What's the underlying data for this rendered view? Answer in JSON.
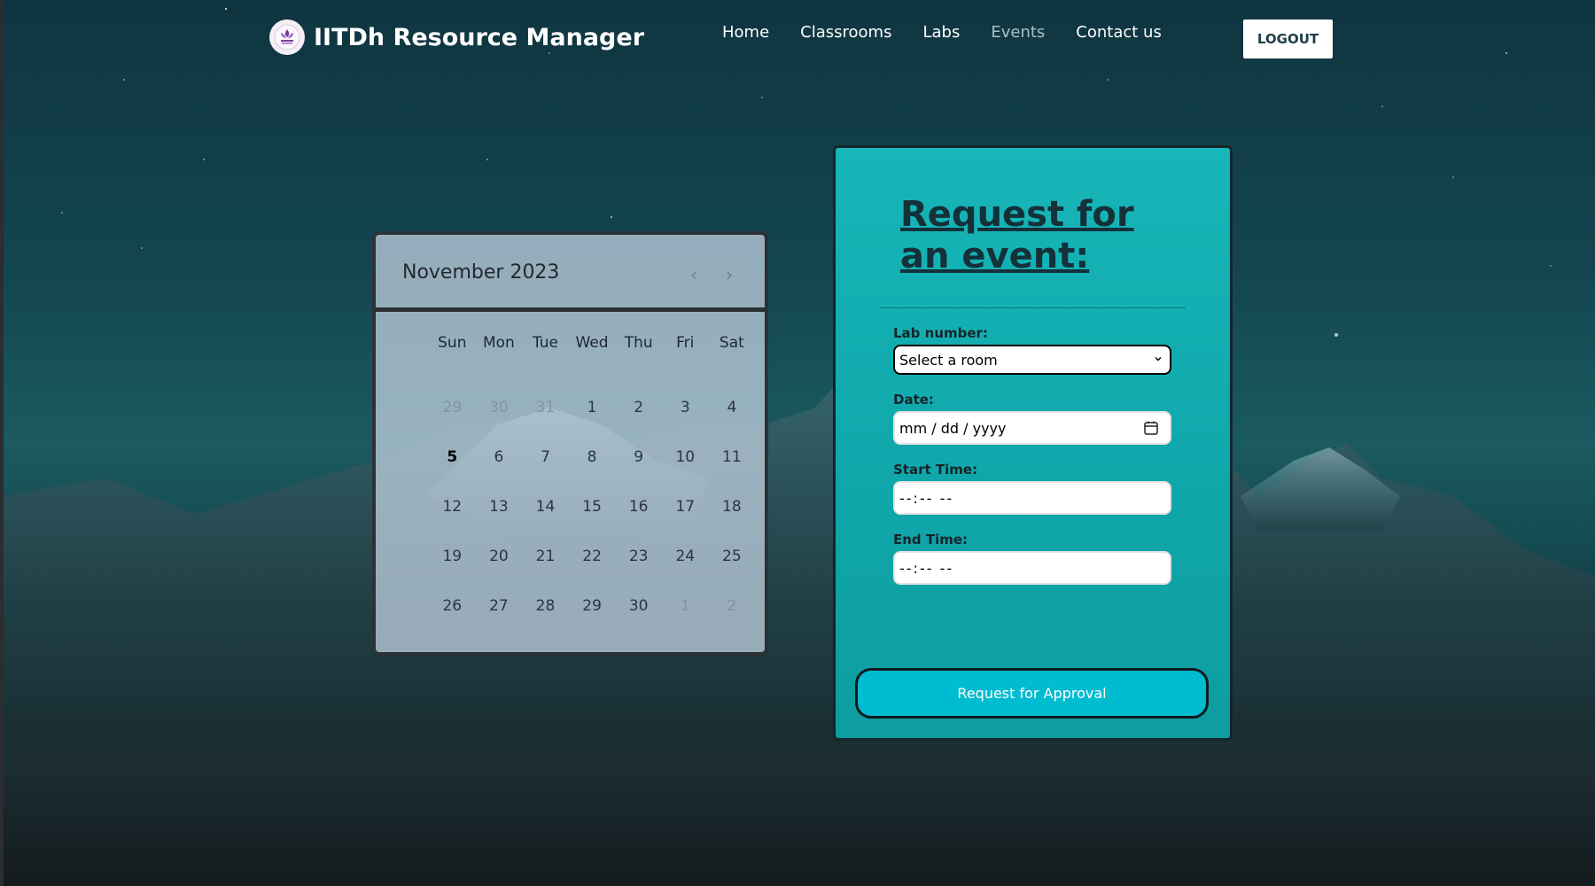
{
  "app": {
    "title": "IITDh Resource Manager"
  },
  "nav": {
    "items": [
      {
        "label": "Home"
      },
      {
        "label": "Classrooms"
      },
      {
        "label": "Labs"
      },
      {
        "label": "Events",
        "active": true
      },
      {
        "label": "Contact us"
      }
    ],
    "logout_label": "LOGOUT"
  },
  "calendar": {
    "month_label": "November 2023",
    "weekdays": [
      "Sun",
      "Mon",
      "Tue",
      "Wed",
      "Thu",
      "Fri",
      "Sat"
    ],
    "weeks": [
      [
        "29",
        "30",
        "31",
        "1",
        "2",
        "3",
        "4"
      ],
      [
        "5",
        "6",
        "7",
        "8",
        "9",
        "10",
        "11"
      ],
      [
        "12",
        "13",
        "14",
        "15",
        "16",
        "17",
        "18"
      ],
      [
        "19",
        "20",
        "21",
        "22",
        "23",
        "24",
        "25"
      ],
      [
        "26",
        "27",
        "28",
        "29",
        "30",
        "1",
        "2"
      ]
    ],
    "today": "5",
    "prev_icon": "chevron-left-icon",
    "next_icon": "chevron-right-icon"
  },
  "form": {
    "title": "Request for an event:",
    "lab_label": "Lab number:",
    "lab_value": "Select a room",
    "date_label": "Date:",
    "date_value": "mm / dd / yyyy",
    "start_label": "Start Time:",
    "start_value": "--:-- --",
    "end_label": "End Time:",
    "end_value": "--:-- --",
    "submit_label": "Request for Approval"
  },
  "colors": {
    "card_bg": "#17b6b8",
    "button_bg": "#00bcd0",
    "nav_active": "#a7c2c7"
  }
}
